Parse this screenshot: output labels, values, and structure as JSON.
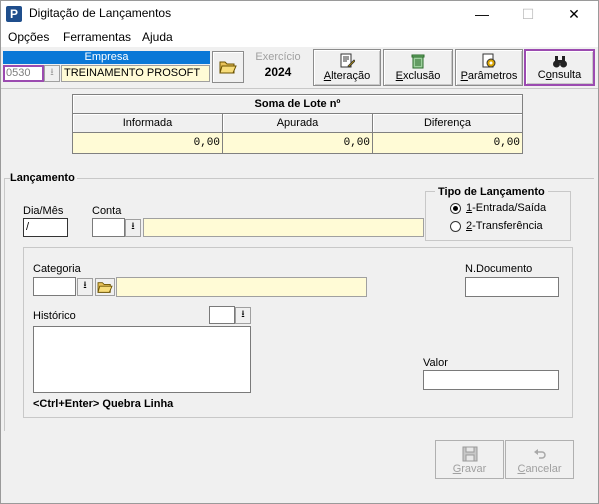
{
  "window": {
    "title": "Digitação de Lançamentos",
    "icon_letter": "P",
    "min_glyph": "—",
    "max_glyph": "☐",
    "close_glyph": "✕"
  },
  "menu": {
    "items": [
      "Opções",
      "Ferramentas",
      "Ajuda"
    ]
  },
  "toolbar": {
    "empresa_label": "Empresa",
    "empresa_code": "0530",
    "empresa_name": "TREINAMENTO PROSOFT",
    "exercicio_label": "Exercício",
    "exercicio_value": "2024",
    "buttons": [
      {
        "pre": "",
        "key": "A",
        "post": "lteração"
      },
      {
        "pre": "",
        "key": "E",
        "post": "xclusão"
      },
      {
        "pre": "",
        "key": "P",
        "post": "arâmetros"
      },
      {
        "pre": "C",
        "key": "o",
        "post": "nsulta"
      }
    ]
  },
  "lote": {
    "title": "Soma de Lote nº",
    "headers": [
      "Informada",
      "Apurada",
      "Diferença"
    ],
    "values": [
      "0,00",
      "0,00",
      "0,00"
    ]
  },
  "lancamento": {
    "section_label": "Lançamento",
    "dia_mes_label": "Dia/Mês",
    "dia_mes_value": " /",
    "conta_label": "Conta",
    "tipo_label": "Tipo de Lançamento",
    "tipo_options": [
      {
        "key": "1",
        "rest": "-Entrada/Saída",
        "checked": true
      },
      {
        "key": "2",
        "rest": "-Transferência",
        "checked": false
      }
    ],
    "categoria_label": "Categoria",
    "ndocumento_label": "N.Documento",
    "historico_label": "Histórico",
    "valor_label": "Valor",
    "quebra_linha_hint": "<Ctrl+Enter> Quebra Linha"
  },
  "actions": {
    "gravar": {
      "key": "G",
      "rest": "ravar"
    },
    "cancelar": {
      "key": "C",
      "rest": "ancelar"
    }
  },
  "colors": {
    "accent_blue": "#0a78d7",
    "highlight_purple": "#9b4bb0",
    "field_yellow": "#fffbd6"
  }
}
